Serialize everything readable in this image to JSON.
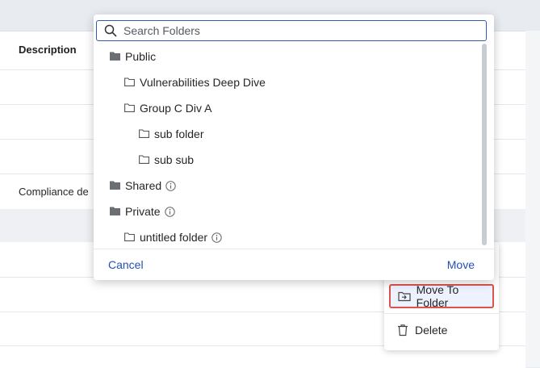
{
  "background": {
    "column_header": "Description",
    "row_text": "Compliance de"
  },
  "search": {
    "placeholder": "Search Folders",
    "value": ""
  },
  "tree": [
    {
      "label": "Public",
      "icon": "folder-filled-icon",
      "level": 0,
      "info": false
    },
    {
      "label": "Vulnerabilities Deep Dive",
      "icon": "folder-outline-icon",
      "level": 1,
      "info": false
    },
    {
      "label": "Group C Div A",
      "icon": "folder-outline-icon",
      "level": 1,
      "info": false
    },
    {
      "label": "sub folder",
      "icon": "folder-outline-icon",
      "level": 2,
      "info": false
    },
    {
      "label": "sub sub",
      "icon": "folder-outline-icon",
      "level": 2,
      "info": false
    },
    {
      "label": "Shared",
      "icon": "folder-filled-icon",
      "level": 0,
      "info": true
    },
    {
      "label": "Private",
      "icon": "folder-filled-icon",
      "level": 0,
      "info": true
    },
    {
      "label": "untitled folder",
      "icon": "folder-outline-icon",
      "level": 1,
      "info": true
    }
  ],
  "footer": {
    "cancel_label": "Cancel",
    "move_label": "Move"
  },
  "action_menu": {
    "move_to_folder_label": "Move To Folder",
    "delete_label": "Delete"
  },
  "colors": {
    "accent": "#2350b5",
    "highlight_border": "#d9534f"
  }
}
